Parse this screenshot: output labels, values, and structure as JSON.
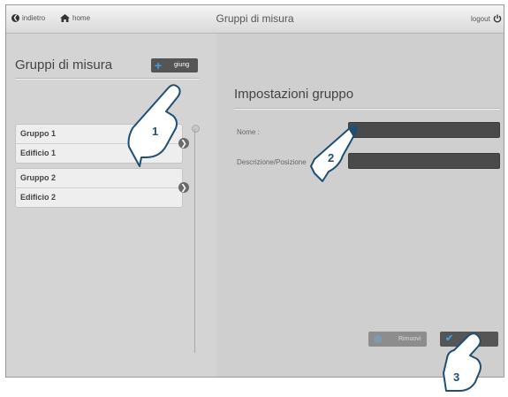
{
  "topbar": {
    "back_label": "indietro",
    "home_label": "home",
    "title": "Gruppi di misura",
    "logout_label": "logout"
  },
  "left_panel": {
    "title": "Gruppi di misura",
    "add_button_label": "giung",
    "groups": [
      {
        "name": "Gruppo 1",
        "building": "Edificio 1"
      },
      {
        "name": "Gruppo 2",
        "building": "Edificio 2"
      }
    ]
  },
  "right_panel": {
    "title": "Impostazioni gruppo",
    "name_label": "Nome :",
    "name_value": "",
    "description_label": "Descrizione/Posizione",
    "description_value": "",
    "remove_label": "Rimuovi",
    "save_label": "Sa"
  },
  "callouts": [
    "1",
    "2",
    "3"
  ],
  "colors": {
    "accent": "#3aa0e6",
    "field_bg": "#4a4a4a"
  }
}
